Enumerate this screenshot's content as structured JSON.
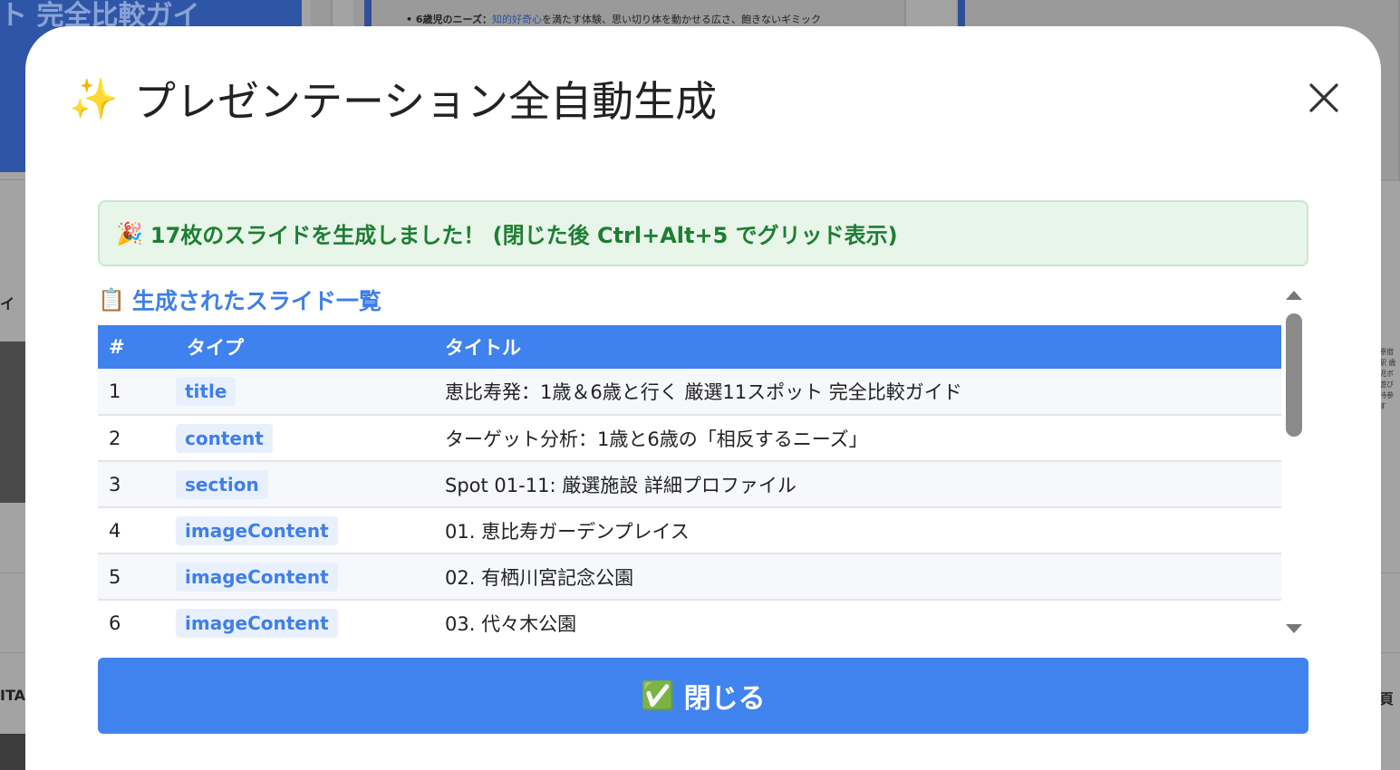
{
  "background": {
    "hero_title": "ト 完全比較ガイ",
    "note_prefix": "• 6歳児のニーズ：",
    "note_highlight": "知的好奇心",
    "note_suffix": "を満たす体験、思い切り体を動かせる広さ、飽きないギミック",
    "side_label_top": "イ",
    "side_label_bottom": "ITA",
    "side_label_right": "頁",
    "right_text": "原宿駅 歳児ボ 遊び 持参す"
  },
  "modal": {
    "title": "プレゼンテーション全自動生成",
    "banner": "17枚のスライドを生成しました！ (閉じた後 Ctrl+Alt+5 でグリッド表示)",
    "list_heading": "生成されたスライド一覧",
    "close_button": "閉じる",
    "icons": {
      "title": "sparkles-icon",
      "banner": "party-popper-icon",
      "list": "clipboard-icon",
      "button": "check-mark-icon",
      "close": "close-icon"
    }
  },
  "table": {
    "headers": [
      "#",
      "タイプ",
      "タイトル"
    ],
    "rows": [
      {
        "num": "1",
        "type": "title",
        "title": "恵比寿発：1歳＆6歳と行く 厳選11スポット 完全比較ガイド"
      },
      {
        "num": "2",
        "type": "content",
        "title": "ターゲット分析：1歳と6歳の「相反するニーズ」"
      },
      {
        "num": "3",
        "type": "section",
        "title": "Spot 01-11: 厳選施設 詳細プロファイル"
      },
      {
        "num": "4",
        "type": "imageContent",
        "title": "01. 恵比寿ガーデンプレイス"
      },
      {
        "num": "5",
        "type": "imageContent",
        "title": "02. 有栖川宮記念公園"
      },
      {
        "num": "6",
        "type": "imageContent",
        "title": "03. 代々木公園"
      }
    ]
  },
  "colors": {
    "accent": "#4183ee",
    "success_bg": "#e8f5e9",
    "success_text": "#1e7e34",
    "badge_bg": "#e9f0fd"
  }
}
